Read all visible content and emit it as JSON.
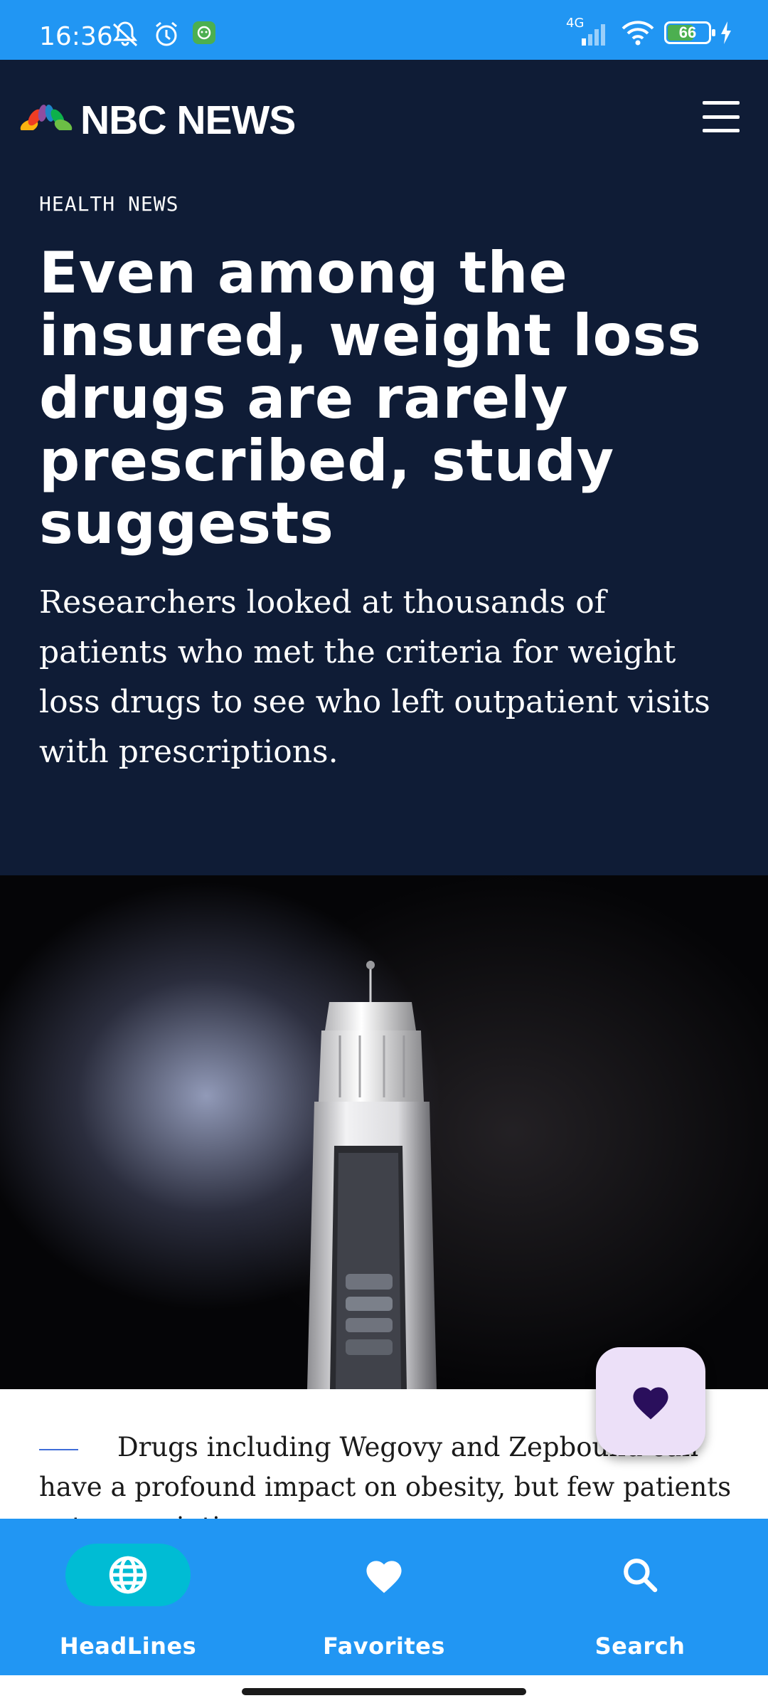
{
  "status_bar": {
    "time": "16:36",
    "network": "4G",
    "battery": "66",
    "battery_level": 0.66
  },
  "header": {
    "logo_text": "NBC NEWS",
    "menu_icon": "hamburger-menu-icon"
  },
  "article": {
    "category": "HEALTH NEWS",
    "headline": "Even among the insured, weight loss drugs are rarely prescribed, study suggests",
    "dek": "Researchers looked at thousands of patients who met the criteria for weight loss drugs to see who left outpatient visits with prescriptions.",
    "body_preview": "Drugs including Wegovy and Zepbound can have a profound impact on obesity, but few patients get prescriptions."
  },
  "fab": {
    "icon": "heart-icon",
    "color": "#2a0f5c"
  },
  "bottom_nav": {
    "items": [
      {
        "label": "HeadLines",
        "icon": "globe-icon",
        "active": true
      },
      {
        "label": "Favorites",
        "icon": "heart-icon",
        "active": false
      },
      {
        "label": "Search",
        "icon": "search-icon",
        "active": false
      }
    ]
  },
  "colors": {
    "status_bar": "#2196f3",
    "header_bg": "#0f1c36",
    "nav_bg": "#2196f3",
    "nav_active": "#00bcd4",
    "fab_bg": "#ece0f8"
  }
}
